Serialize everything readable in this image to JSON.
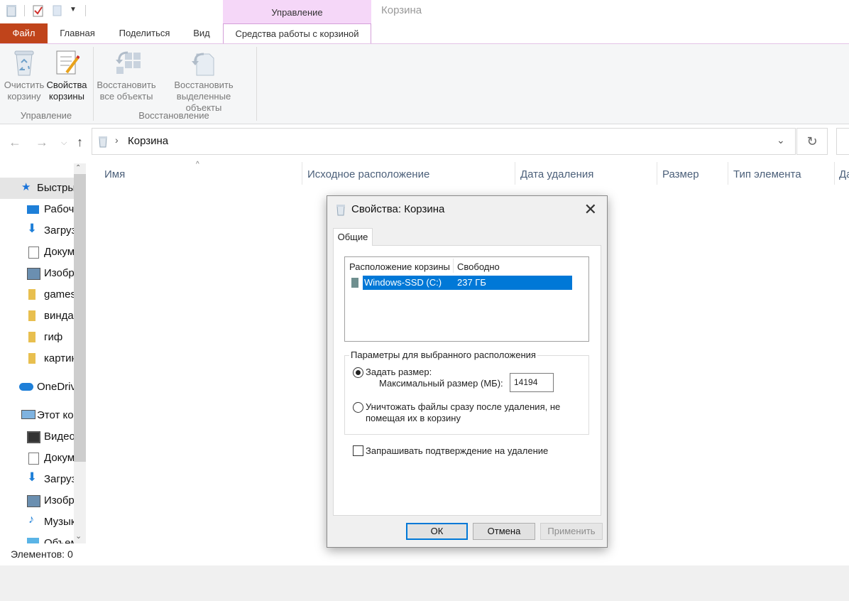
{
  "titlebar": {
    "context_group": "Управление",
    "window_title": "Корзина"
  },
  "tabs": {
    "file": "Файл",
    "home": "Главная",
    "share": "Поделиться",
    "view": "Вид",
    "recycle_tools": "Средства работы с корзиной"
  },
  "ribbon": {
    "empty_l1": "Очистить",
    "empty_l2": "корзину",
    "props_l1": "Свойства",
    "props_l2": "корзины",
    "group_manage": "Управление",
    "restore_all_l1": "Восстановить",
    "restore_all_l2": "все объекты",
    "restore_sel_l1": "Восстановить",
    "restore_sel_l2": "выделенные объекты",
    "group_restore": "Восстановление"
  },
  "address": {
    "location": "Корзина"
  },
  "nav": {
    "quick": "Быстрый доступ",
    "items": [
      "Рабочий стол",
      "Загрузки",
      "Документы",
      "Изображения",
      "games",
      "винда",
      "гиф",
      "картинки"
    ],
    "onedrive": "OneDrive",
    "thispc": "Этот компьютер",
    "pc_items": [
      "Видео",
      "Документы",
      "Загрузки",
      "Изображения",
      "Музыка",
      "Объемные объекты"
    ]
  },
  "columns": {
    "name": "Имя",
    "origin": "Исходное расположение",
    "deleted": "Дата удаления",
    "size": "Размер",
    "type": "Тип элемента",
    "modified": "Да"
  },
  "status": {
    "items": "Элементов: 0"
  },
  "dialog": {
    "title": "Свойства: Корзина",
    "tab": "Общие",
    "list_col1": "Расположение корзины",
    "list_col2": "Свободно",
    "drive": "Windows-SSD (C:)",
    "free": "237 ГБ",
    "group_label": "Параметры для выбранного расположения",
    "opt_custom": "Задать размер:",
    "max_label": "Максимальный размер (МБ):",
    "max_value": "14194",
    "opt_delete_l1": "Уничтожать файлы сразу после удаления, не",
    "opt_delete_l2": "помещая их в корзину",
    "confirm": "Запрашивать подтверждение на удаление",
    "ok": "ОК",
    "cancel": "Отмена",
    "apply": "Применить"
  },
  "colors": {
    "file_tab": "#c0441b",
    "context_tab": "#f5d7f8",
    "accent": "#0078d7"
  }
}
